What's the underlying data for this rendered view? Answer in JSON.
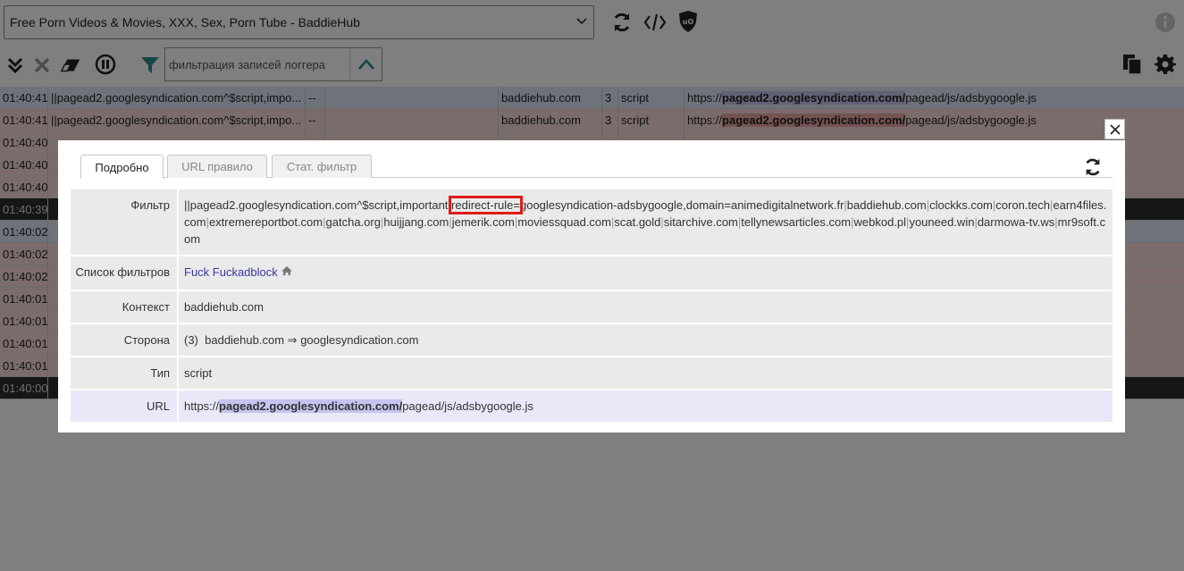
{
  "toolbar": {
    "tab_title": "Free Porn Videos & Movies, XXX, Sex, Porn Tube - BaddieHub",
    "filter_placeholder": "фильтрация записей логгера"
  },
  "log": {
    "rows": [
      {
        "time": "01:40:41",
        "filter": "||pagead2.googlesyndication.com^$script,impo...",
        "dash": "--",
        "context": "baddiehub.com",
        "party": "3",
        "type": "script",
        "url_pre": "https://",
        "url_host": "pagead2.googlesyndication.com/",
        "url_post": "pagead/js/adsbygoogle.js",
        "kind": "allowed"
      },
      {
        "time": "01:40:41",
        "filter": "||pagead2.googlesyndication.com^$script,impo...",
        "dash": "--",
        "context": "baddiehub.com",
        "party": "3",
        "type": "script",
        "url_pre": "https://",
        "url_host": "pagead2.googlesyndication.com/",
        "url_post": "pagead/js/adsbygoogle.js",
        "kind": "blocked"
      },
      {
        "time": "01:40:40",
        "kind": "blocked"
      },
      {
        "time": "01:40:40",
        "kind": "blocked"
      },
      {
        "time": "01:40:40",
        "kind": "blocked"
      },
      {
        "time": "01:40:39",
        "kind": "dark"
      },
      {
        "time": "01:40:02",
        "kind": "allowed"
      },
      {
        "time": "01:40:02",
        "kind": "blocked"
      },
      {
        "time": "01:40:02",
        "kind": "blocked"
      },
      {
        "time": "01:40:01",
        "kind": "blocked"
      },
      {
        "time": "01:40:01",
        "kind": "blocked"
      },
      {
        "time": "01:40:01",
        "kind": "blocked"
      },
      {
        "time": "01:40:01",
        "kind": "blocked"
      },
      {
        "time": "01:40:00",
        "kind": "dark"
      }
    ]
  },
  "modal": {
    "tabs": [
      "Подробно",
      "URL правило",
      "Стат. фильтр"
    ],
    "labels": {
      "filter": "Фильтр",
      "list": "Список фильтров",
      "context": "Контекст",
      "party": "Сторона",
      "type": "Тип",
      "url": "URL"
    },
    "filter_pre": "||pagead2.googlesyndication.com^$script,important,",
    "filter_highlight": "redirect-rule=",
    "filter_rest_first": "googlesyndication-adsbygoogle,domain=animedigitalnetwork.fr",
    "filter_domains": [
      "baddiehub.com",
      "clockks.com",
      "coron.tech",
      "earn4files.com",
      "extremereportbot.com",
      "gatcha.org",
      "huijjang.com",
      "jemerik.com",
      "moviessquad.com",
      "scat.gold",
      "sitarchive.com",
      "tellynewsarticles.com",
      "webkod.pl",
      "youneed.win",
      "darmowa-tv.ws",
      "mr9soft.com"
    ],
    "list_name": "Fuck Fuckadblock",
    "context": "baddiehub.com",
    "party_num": "(3)",
    "party_from": "baddiehub.com",
    "party_arrow": "⇒",
    "party_to": "googlesyndication.com",
    "type": "script",
    "url_pre": "https://",
    "url_host": "pagead2.googlesyndication.com/",
    "url_post": "pagead/js/adsbygoogle.js"
  }
}
